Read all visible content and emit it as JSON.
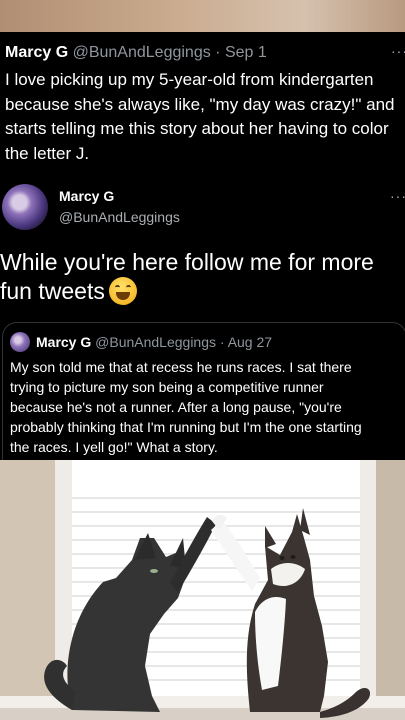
{
  "top_tweet": {
    "author_name": "Marcy G",
    "handle": "@BunAndLeggings",
    "separator": "·",
    "date": "Sep 1",
    "text": "I love picking up my 5-year-old from kindergarten\nbecause she's always like, \"my day was crazy!\" and\nstarts telling me this story about her having to color\nthe letter J."
  },
  "profile": {
    "name": "Marcy G",
    "handle": "@BunAndLeggings",
    "more_icon": "more-icon"
  },
  "promo_text": "While you're here follow me for more\nfun tweets",
  "promo_emoji": "grinning-sweat-emoji",
  "quoted_tweet": {
    "author_name": "Marcy G",
    "handle": "@BunAndLeggings",
    "separator": "·",
    "date": "Aug 27",
    "text": "My son told me that at recess he runs races. I sat there\ntrying to picture my son being a competitive runner\nbecause he's not a runner. After a long pause, \"you're\nprobably thinking that I'm running but I'm the one starting\nthe races. I yell go!\" What a story."
  },
  "colors": {
    "background": "#000000",
    "text": "#ffffff",
    "secondary_text": "#8f969c",
    "border": "#2f3336"
  }
}
